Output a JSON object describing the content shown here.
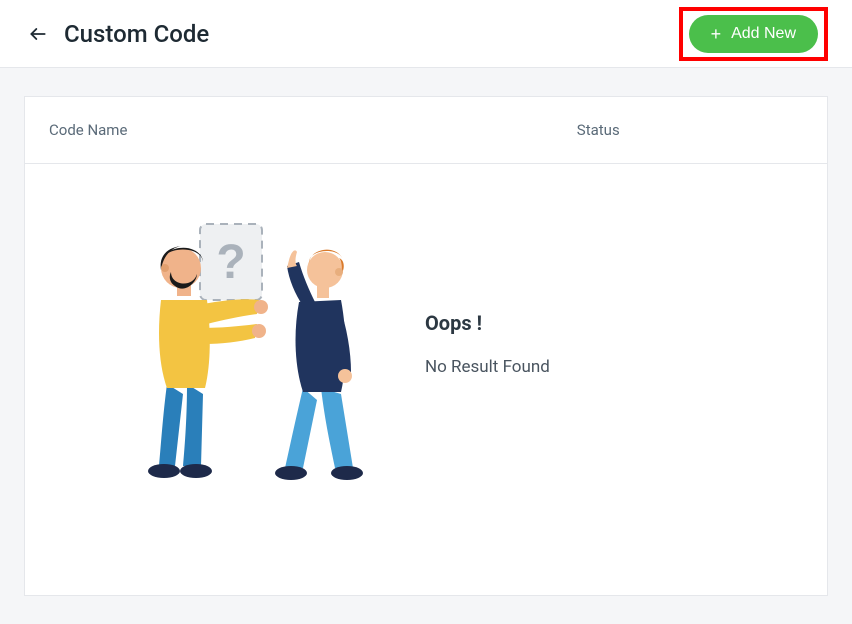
{
  "header": {
    "title": "Custom Code",
    "add_button_label": "Add New"
  },
  "table": {
    "columns": {
      "name": "Code Name",
      "status": "Status"
    }
  },
  "empty_state": {
    "heading": "Oops !",
    "message": "No Result Found"
  }
}
